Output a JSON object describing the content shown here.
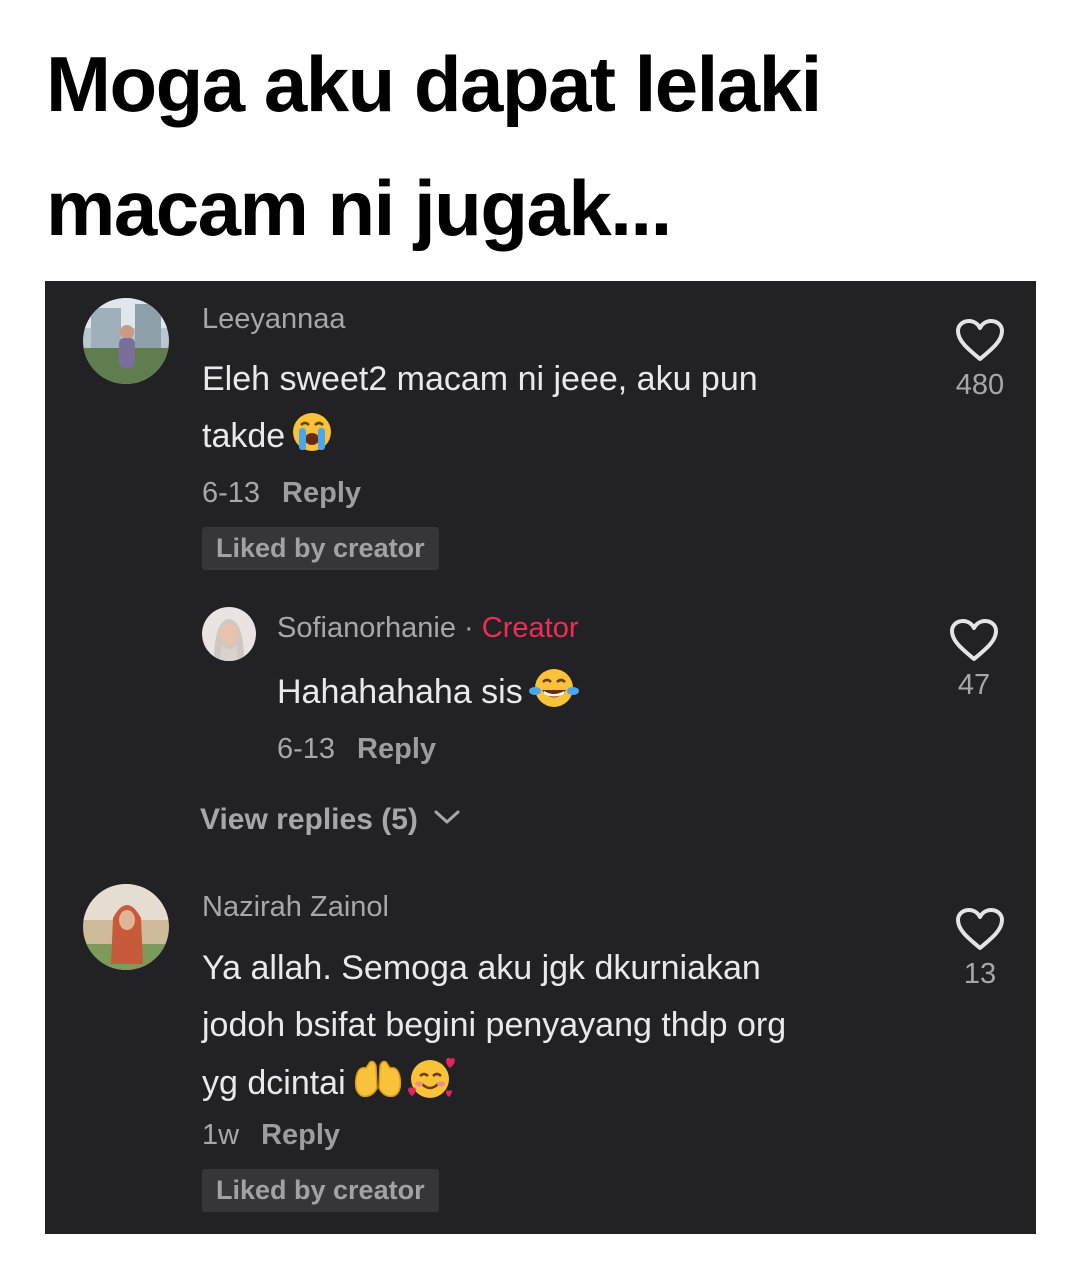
{
  "headline": {
    "line1": "Moga aku dapat lelaki",
    "line2": "macam ni jugak..."
  },
  "comments": [
    {
      "username": "Leeyannaa",
      "text_line1": "Eleh sweet2 macam ni jeee, aku pun",
      "text_line2": "takde",
      "date": "6-13",
      "reply_label": "Reply",
      "badge": "Liked by creator",
      "likes": "480"
    },
    {
      "username": "Sofianorhanie",
      "separator": "·",
      "creator_label": "Creator",
      "text": "Hahahahaha sis",
      "date": "6-13",
      "reply_label": "Reply",
      "likes": "47"
    },
    {
      "view_replies": "View replies (5)"
    },
    {
      "username": "Nazirah Zainol",
      "text_line1": "Ya allah. Semoga aku jgk dkurniakan",
      "text_line2": "jodoh bsifat begini penyayang thdp org",
      "text_line3": "yg dcintai",
      "date": "1w",
      "reply_label": "Reply",
      "badge": "Liked by creator",
      "likes": "13"
    }
  ],
  "colors": {
    "panel_bg": "#222224",
    "creator": "#ef2c56",
    "muted": "#a7a7aa"
  },
  "icons": [
    "heart-outline-icon",
    "chevron-down-icon",
    "loudly-crying-face-emoji",
    "tears-of-joy-emoji",
    "palms-up-together-emoji",
    "smiling-face-with-hearts-emoji"
  ]
}
